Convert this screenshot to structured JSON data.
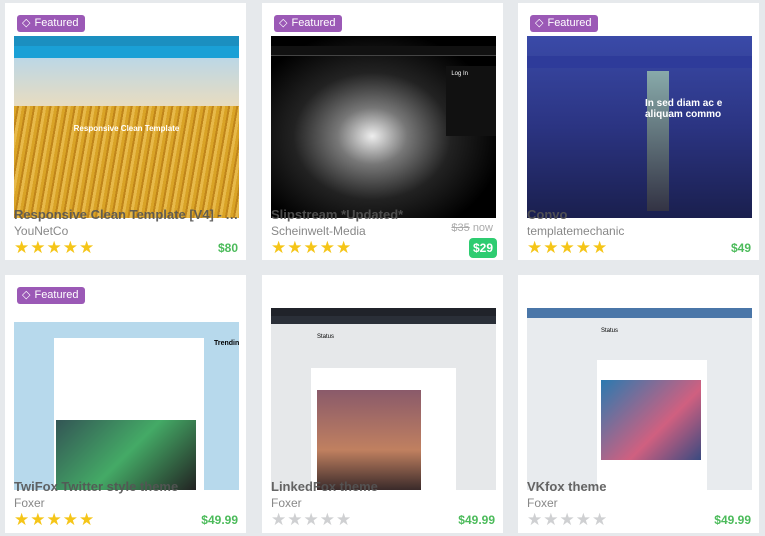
{
  "featured_label": "Featured",
  "colors": {
    "featured": "#9b59b6",
    "price": "#4cbb5b",
    "star_on": "#f5c518",
    "star_off": "#cfd0d2"
  },
  "cards": [
    {
      "title": "Responsive Clean Template [V4] - Yo...",
      "author": "YouNetCo",
      "rating": 5,
      "price": "$80",
      "featured": true,
      "thumb_text": "Responsive Clean Template"
    },
    {
      "title": "Slipstream *Updated*",
      "author": "Scheinwelt-Media",
      "rating": 5,
      "old_price": "$35",
      "old_suffix": "now",
      "price": "$29",
      "featured": true,
      "thumb_text": "Log In"
    },
    {
      "title": "Convo",
      "author": "templatemechanic",
      "rating": 5,
      "price": "$49",
      "featured": true,
      "thumb_text": "In sed diam ac e aliquam commo"
    },
    {
      "title": "TwiFox Twitter style theme",
      "author": "Foxer",
      "rating": 5,
      "price": "$49.99",
      "featured": true,
      "thumb_text": "Trending"
    },
    {
      "title": "LinkedFox theme",
      "author": "Foxer",
      "rating": 0,
      "price": "$49.99",
      "featured": false,
      "thumb_text": "Status"
    },
    {
      "title": "VKfox theme",
      "author": "Foxer",
      "rating": 0,
      "price": "$49.99",
      "featured": false,
      "thumb_text": "Status"
    }
  ]
}
